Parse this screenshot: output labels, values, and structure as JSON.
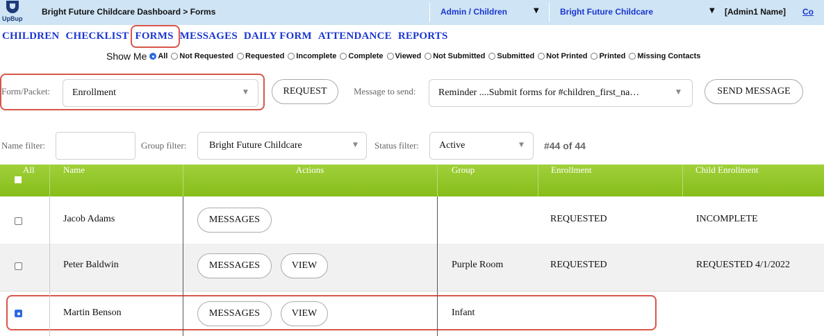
{
  "header": {
    "logo_text": "UpBup",
    "breadcrumb": "Bright Future Childcare Dashboard > Forms",
    "role_select": "Admin / Children",
    "center_select": "Bright Future Childcare",
    "admin_name": "[Admin1 Name]",
    "admin_link": "Co"
  },
  "nav": {
    "children": "CHILDREN",
    "checklist": "CHECKLIST",
    "forms": "FORMS",
    "messages": "MESSAGES",
    "daily_form": "DAILY FORM",
    "attendance": "ATTENDANCE",
    "reports": "REPORTS"
  },
  "show_me": {
    "label": "Show Me",
    "options": [
      "All",
      "Not Requested",
      "Requested",
      "Incomplete",
      "Complete",
      "Viewed",
      "Not Submitted",
      "Submitted",
      "Not Printed",
      "Printed",
      "Missing Contacts"
    ],
    "selected": "All"
  },
  "controls": {
    "form_packet_label": "Form/Packet:",
    "form_packet_value": "Enrollment",
    "request_button": "REQUEST",
    "message_label": "Message to send:",
    "message_value": "Reminder ....Submit forms for #children_first_na…",
    "send_button": "SEND MESSAGE"
  },
  "filters": {
    "name_label": "Name filter:",
    "name_value": "",
    "group_label": "Group filter:",
    "group_value": "Bright Future Childcare",
    "status_label": "Status filter:",
    "status_value": "Active",
    "count": "#44 of 44"
  },
  "table": {
    "columns": [
      "All",
      "Name",
      "Actions",
      "Group",
      "Enrollment",
      "Child Enrollment"
    ],
    "rows": [
      {
        "name": "Jacob Adams",
        "actions": [
          "MESSAGES"
        ],
        "group": "",
        "enrollment": "REQUESTED",
        "child_enrollment": "INCOMPLETE",
        "checked": false
      },
      {
        "name": "Peter Baldwin",
        "actions": [
          "MESSAGES",
          "VIEW"
        ],
        "group": "Purple Room",
        "enrollment": "REQUESTED",
        "child_enrollment": "REQUESTED 4/1/2022",
        "checked": false
      },
      {
        "name": "Martin Benson",
        "actions": [
          "MESSAGES",
          "VIEW"
        ],
        "group": "Infant",
        "enrollment": "",
        "child_enrollment": "",
        "checked": true
      }
    ]
  },
  "colors": {
    "topbar": "#cfe4f4",
    "link_blue": "#1a36d0",
    "table_header": "#8cc21e",
    "highlight": "#d9554a"
  }
}
